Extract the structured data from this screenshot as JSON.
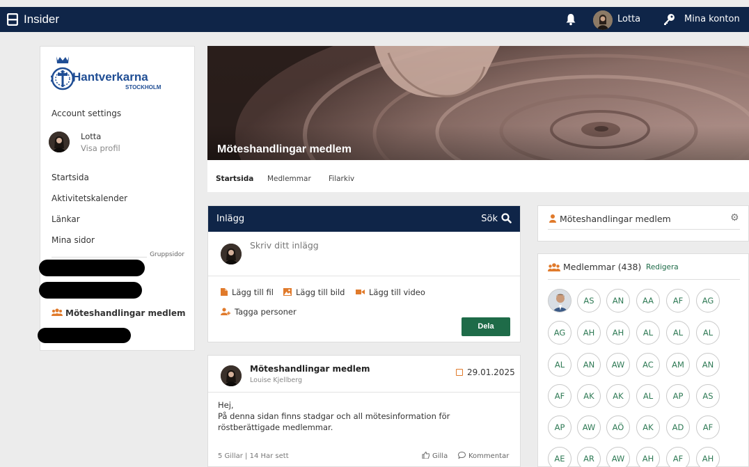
{
  "topbar": {
    "app_title": "Insider",
    "user_name": "Lotta",
    "accounts_label": "Mina konton"
  },
  "sidebar": {
    "logo_brand": "Hantverkarna",
    "logo_city": "STOCKHOLM",
    "account_settings": "Account settings",
    "profile_name": "Lotta",
    "profile_link": "Visa profil",
    "nav": [
      "Startsida",
      "Aktivitetskalender",
      "Länkar",
      "Mina sidor"
    ],
    "group_section_label": "Gruppsidor",
    "group_item": "Möteshandlingar medlem"
  },
  "hero": {
    "title": "Möteshandlingar medlem"
  },
  "tabs": [
    "Startsida",
    "Medlemmar",
    "Filarkiv"
  ],
  "posts": {
    "header_title": "Inlägg",
    "search_label": "Sök",
    "composer_placeholder": "Skriv ditt inlägg",
    "add_file": "Lägg till fil",
    "add_image": "Lägg till bild",
    "add_video": "Lägg till video",
    "tag_people": "Tagga personer",
    "share_button": "Dela"
  },
  "post": {
    "title": "Möteshandlingar medlem",
    "author": "Louise Kjellberg",
    "date": "29.01.2025",
    "greeting": "Hej,",
    "body": "På denna sidan finns stadgar och all mötesinformation för röstberättigade medlemmar.",
    "stats": "5 Gillar | 14 Har sett",
    "like_label": "Gilla",
    "comment_label": "Kommentar"
  },
  "group_card": {
    "title": "Möteshandlingar medlem"
  },
  "members": {
    "title": "Medlemmar (438)",
    "edit_label": "Redigera",
    "initials": [
      "AS",
      "AN",
      "AA",
      "AF",
      "AG",
      "AG",
      "AH",
      "AH",
      "AL",
      "AL",
      "AL",
      "AL",
      "AN",
      "AW",
      "AC",
      "AM",
      "AN",
      "AF",
      "AK",
      "AK",
      "AL",
      "AP",
      "AS",
      "AP",
      "AW",
      "AÖ",
      "AK",
      "AD",
      "AF",
      "AE",
      "AR",
      "AW",
      "AH",
      "AF",
      "AH"
    ]
  },
  "colors": {
    "navy": "#0f2548",
    "accent_orange": "#e07a2b",
    "member_green": "#2f7a55",
    "share_green": "#1e6b48"
  },
  "icons": [
    "menu-logo-icon",
    "bell-icon",
    "key-icon",
    "search-icon",
    "file-icon",
    "image-icon",
    "video-icon",
    "tag-people-icon",
    "calendar-icon",
    "thumbs-up-icon",
    "comment-icon",
    "user-icon",
    "users-icon",
    "gear-icon"
  ]
}
